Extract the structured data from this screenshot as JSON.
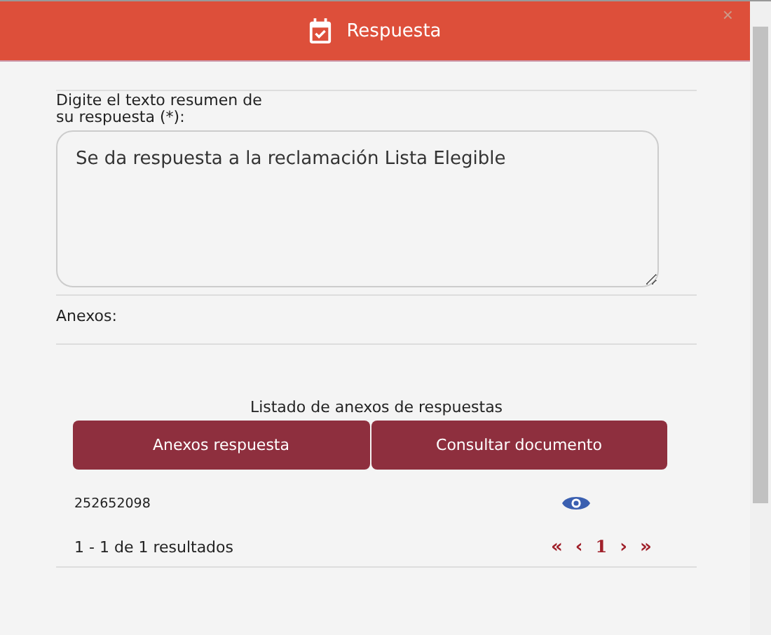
{
  "dialog": {
    "title": "Respuesta",
    "close": "×"
  },
  "form": {
    "summary_label": "Digite el texto resumen de su respuesta (*):",
    "summary_value": "Se da respuesta a la reclamación Lista Elegible",
    "attachments_label": "Anexos:"
  },
  "list": {
    "title": "Listado de anexos de respuestas",
    "columns": [
      "Anexos respuesta",
      "Consultar documento"
    ],
    "rows": [
      {
        "value": "252652098"
      }
    ],
    "results": "1 - 1 de 1 resultados",
    "pager": [
      {
        "label": "«",
        "kind": "nav"
      },
      {
        "label": "‹",
        "kind": "nav"
      },
      {
        "label": "1",
        "kind": "page"
      },
      {
        "label": "›",
        "kind": "nav"
      },
      {
        "label": "»",
        "kind": "nav"
      }
    ]
  }
}
